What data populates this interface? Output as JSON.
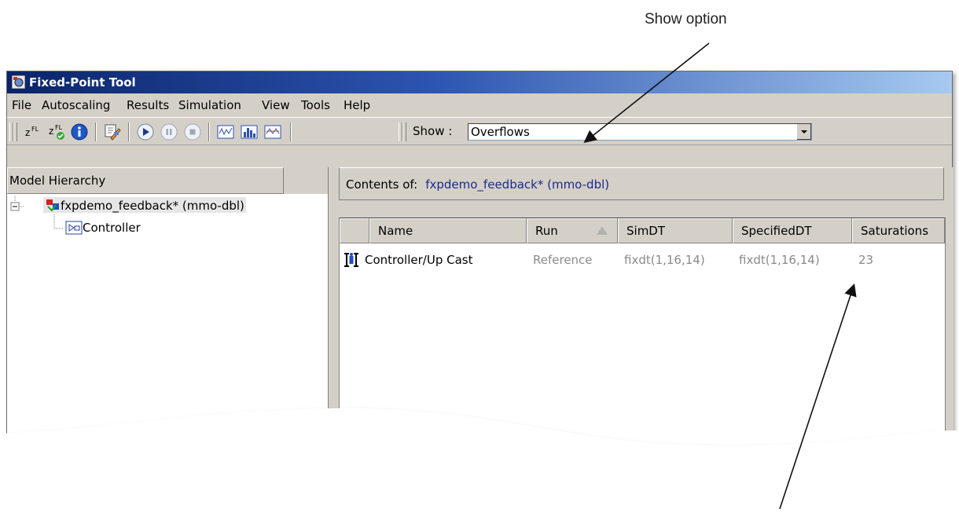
{
  "annotations": {
    "show_option": "Show option"
  },
  "window": {
    "title": "Fixed-Point Tool"
  },
  "menubar": {
    "items": [
      "File",
      "Autoscaling",
      "Results",
      "Simulation",
      "View",
      "Tools",
      "Help"
    ]
  },
  "toolbar": {
    "icons": [
      "fl-scale-icon",
      "fl-propose-icon",
      "info-icon",
      "autoscale-icon",
      "play-icon",
      "pause-icon",
      "stop-icon",
      "plot-signal-icon",
      "histogram-icon",
      "compare-plot-icon"
    ],
    "show_label": "Show :",
    "show_value": "Overflows"
  },
  "left_panel": {
    "header": "Model Hierarchy",
    "tree": [
      {
        "label": "fxpdemo_feedback* (mmo-dbl)",
        "level": 0,
        "expanded": true,
        "icon": "model-icon"
      },
      {
        "label": "Controller",
        "level": 1,
        "icon": "subsystem-icon"
      }
    ]
  },
  "right_panel": {
    "contents_label": "Contents of:",
    "contents_value": "fxpdemo_feedback* (mmo-dbl)",
    "columns": [
      "",
      "Name",
      "Run",
      "SimDT",
      "SpecifiedDT",
      "Saturations"
    ],
    "sorted_column": "Run",
    "rows": [
      {
        "icon": "signal-range-icon",
        "name": "Controller/Up Cast",
        "run": "Reference",
        "simdt": "fixdt(1,16,14)",
        "specifieddt": "fixdt(1,16,14)",
        "saturations": "23"
      }
    ]
  },
  "colors": {
    "title_bar_start": "#0a246a",
    "title_bar_end": "#a6caf0",
    "contents_value": "#1a2a8c",
    "window_face": "#d4d0c8"
  }
}
